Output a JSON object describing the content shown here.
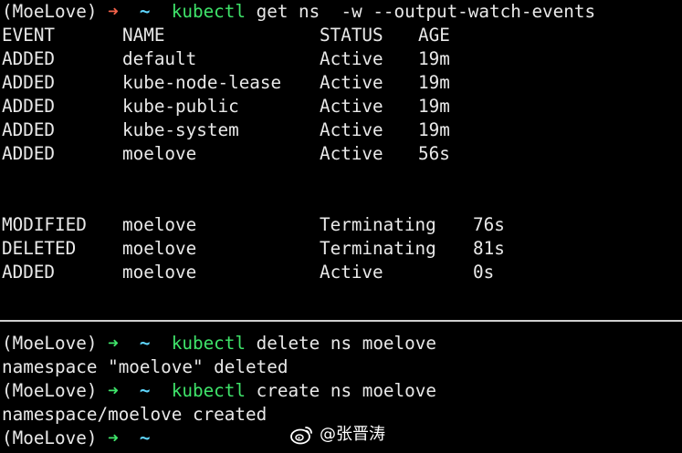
{
  "top_pane": {
    "prompt": {
      "user": "(MoeLove)",
      "arrow": "➜",
      "cwd": "~",
      "command": "kubectl",
      "args": " get ns  -w --output-watch-events"
    },
    "headers": [
      "EVENT",
      "NAME",
      "STATUS",
      "AGE"
    ],
    "rows_initial": [
      {
        "event": "ADDED",
        "name": "default",
        "status": "Active",
        "age": "19m"
      },
      {
        "event": "ADDED",
        "name": "kube-node-lease",
        "status": "Active",
        "age": "19m"
      },
      {
        "event": "ADDED",
        "name": "kube-public",
        "status": "Active",
        "age": "19m"
      },
      {
        "event": "ADDED",
        "name": "kube-system",
        "status": "Active",
        "age": "19m"
      },
      {
        "event": "ADDED",
        "name": "moelove",
        "status": "Active",
        "age": "56s"
      }
    ],
    "rows_events": [
      {
        "event": "MODIFIED",
        "name": "moelove",
        "status": "Terminating",
        "age": "76s"
      },
      {
        "event": "DELETED",
        "name": "moelove",
        "status": "Terminating",
        "age": "81s"
      },
      {
        "event": "ADDED",
        "name": "moelove",
        "status": "Active",
        "age": "0s"
      }
    ]
  },
  "bottom_pane": {
    "lines": [
      {
        "type": "prompt",
        "user": "(MoeLove)",
        "arrow": "➜",
        "cwd": "~",
        "command": "kubectl",
        "args": " delete ns moelove"
      },
      {
        "type": "output",
        "text": "namespace \"moelove\" deleted"
      },
      {
        "type": "prompt",
        "user": "(MoeLove)",
        "arrow": "➜",
        "cwd": "~",
        "command": "kubectl",
        "args": " create ns moelove"
      },
      {
        "type": "output",
        "text": "namespace/moelove created"
      },
      {
        "type": "prompt",
        "user": "(MoeLove)",
        "arrow": "➜",
        "cwd": "~",
        "command": "",
        "args": ""
      }
    ]
  },
  "watermark": {
    "text": "@张晋涛",
    "icon": "weibo-icon"
  },
  "colors": {
    "background": "#000000",
    "foreground": "#e9e9e9",
    "arrow_error": "#f2624a",
    "arrow_ok": "#3fe46a",
    "command": "#3fe46a",
    "cwd": "#5fd7ff",
    "divider": "#d0d0d0"
  }
}
